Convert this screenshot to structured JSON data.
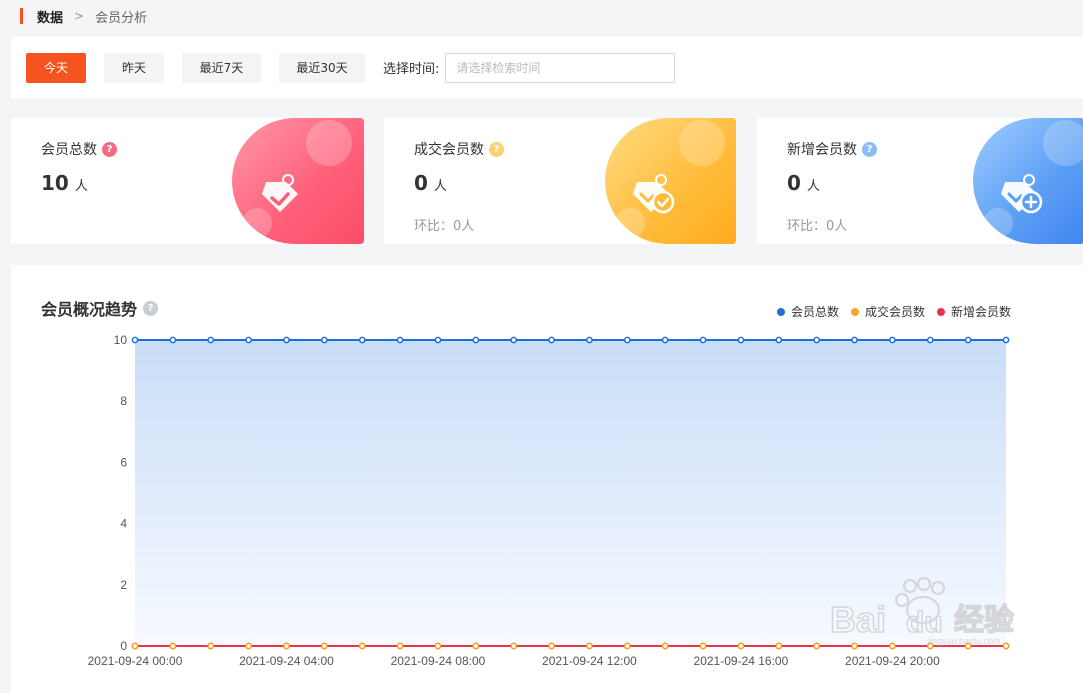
{
  "breadcrumb": {
    "root": "数据",
    "separator": ">",
    "current": "会员分析"
  },
  "filters": {
    "buttons": [
      {
        "label": "今天",
        "active": true
      },
      {
        "label": "昨天",
        "active": false
      },
      {
        "label": "最近7天",
        "active": false
      },
      {
        "label": "最近30天",
        "active": false
      }
    ],
    "time_label": "选择时间:",
    "time_placeholder": "请选择检索时间"
  },
  "cards": [
    {
      "label": "会员总数",
      "value": "10",
      "unit": "人",
      "ratio": "",
      "help_color": "#f26d84",
      "icon": "diamond-check-icon"
    },
    {
      "label": "成交会员数",
      "value": "0",
      "unit": "人",
      "ratio": "环比：0人",
      "help_color": "#fdd170",
      "icon": "diamond-check-circle-icon"
    },
    {
      "label": "新增会员数",
      "value": "0",
      "unit": "人",
      "ratio": "环比：0人",
      "help_color": "#8dbcf4",
      "icon": "diamond-plus-icon"
    }
  ],
  "chart": {
    "title": "会员概况趋势",
    "legend": [
      {
        "name": "会员总数",
        "color": "#1f6fd6"
      },
      {
        "name": "成交会员数",
        "color": "#f5a623"
      },
      {
        "name": "新增会员数",
        "color": "#e8334f"
      }
    ]
  },
  "chart_data": {
    "type": "line",
    "title": "会员概况趋势",
    "xlabel": "",
    "ylabel": "",
    "ylim": [
      0,
      10
    ],
    "yticks": [
      0,
      2,
      4,
      6,
      8,
      10
    ],
    "xtick_labels": [
      "2021-09-24 00:00",
      "2021-09-24 04:00",
      "2021-09-24 08:00",
      "2021-09-24 12:00",
      "2021-09-24 16:00",
      "2021-09-24 20:00"
    ],
    "x": [
      "00:00",
      "01:00",
      "02:00",
      "03:00",
      "04:00",
      "05:00",
      "06:00",
      "07:00",
      "08:00",
      "09:00",
      "10:00",
      "11:00",
      "12:00",
      "13:00",
      "14:00",
      "15:00",
      "16:00",
      "17:00",
      "18:00",
      "19:00",
      "20:00",
      "21:00",
      "22:00",
      "23:00"
    ],
    "series": [
      {
        "name": "会员总数",
        "color": "#1f6fd6",
        "area": true,
        "values": [
          10,
          10,
          10,
          10,
          10,
          10,
          10,
          10,
          10,
          10,
          10,
          10,
          10,
          10,
          10,
          10,
          10,
          10,
          10,
          10,
          10,
          10,
          10,
          10
        ]
      },
      {
        "name": "成交会员数",
        "color": "#f5a623",
        "area": false,
        "values": [
          0,
          0,
          0,
          0,
          0,
          0,
          0,
          0,
          0,
          0,
          0,
          0,
          0,
          0,
          0,
          0,
          0,
          0,
          0,
          0,
          0,
          0,
          0,
          0
        ]
      },
      {
        "name": "新增会员数",
        "color": "#e8334f",
        "area": false,
        "values": [
          0,
          0,
          0,
          0,
          0,
          0,
          0,
          0,
          0,
          0,
          0,
          0,
          0,
          0,
          0,
          0,
          0,
          0,
          0,
          0,
          0,
          0,
          0,
          0
        ]
      }
    ],
    "grid": true,
    "legend_position": "top-right"
  }
}
